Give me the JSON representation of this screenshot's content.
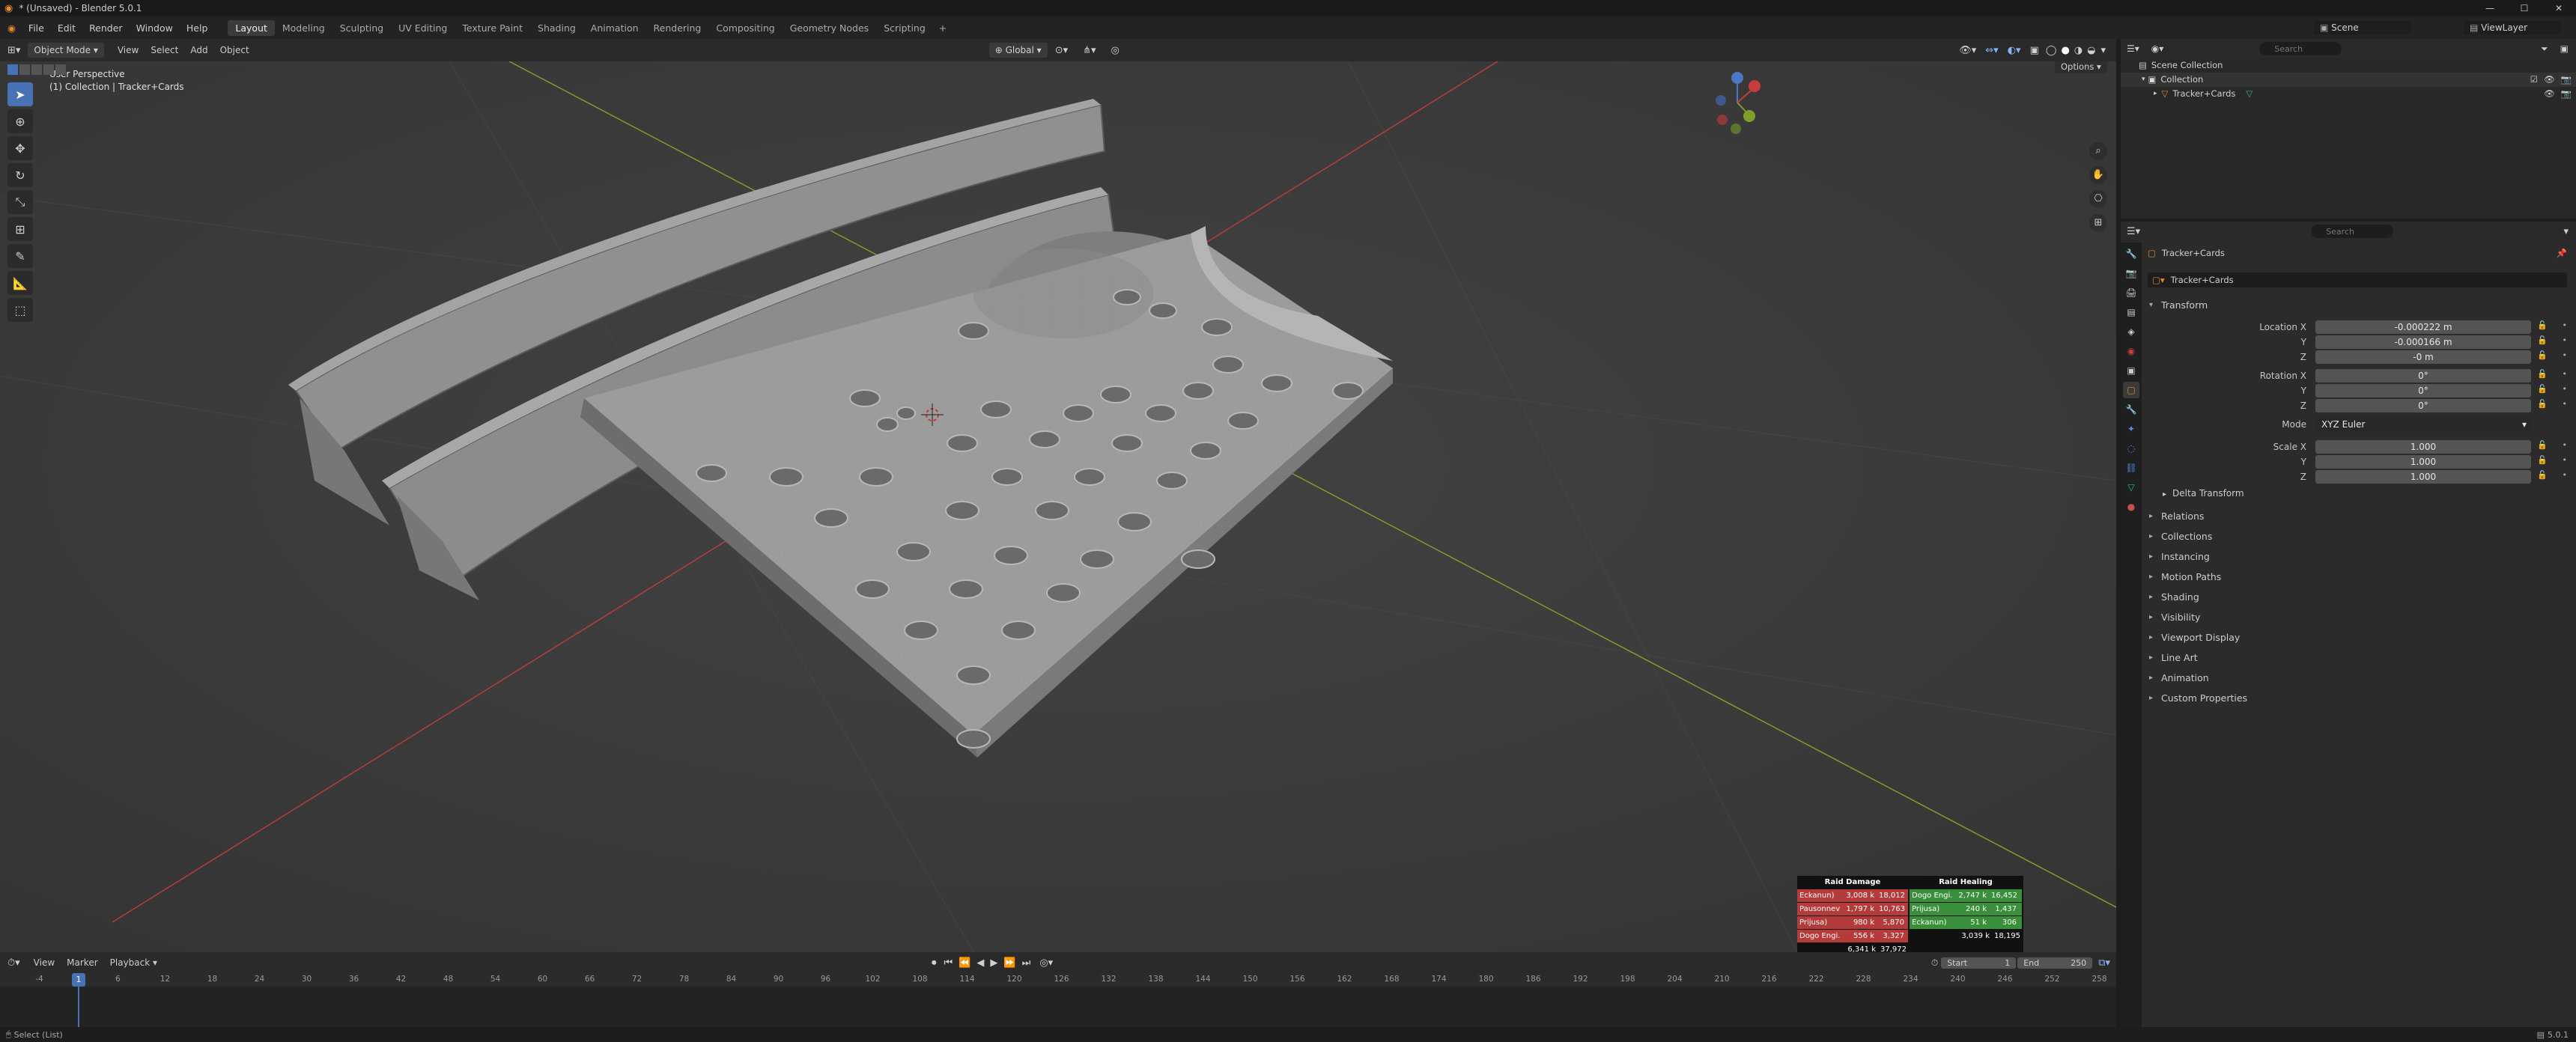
{
  "window": {
    "title": "* (Unsaved) - Blender 5.0.1"
  },
  "menu": {
    "file": "File",
    "edit": "Edit",
    "render": "Render",
    "window": "Window",
    "help": "Help"
  },
  "workspaces": [
    "Layout",
    "Modeling",
    "Sculpting",
    "UV Editing",
    "Texture Paint",
    "Shading",
    "Animation",
    "Rendering",
    "Compositing",
    "Geometry Nodes",
    "Scripting"
  ],
  "scene": {
    "name": "Scene",
    "view_layer": "ViewLayer"
  },
  "viewport_header": {
    "mode": "Object Mode",
    "view": "View",
    "select": "Select",
    "add": "Add",
    "object": "Object",
    "transform": "Global",
    "options": "Options"
  },
  "viewport": {
    "perspective": "User Perspective",
    "context": "(1) Collection | Tracker+Cards"
  },
  "outliner": {
    "search_placeholder": "Search",
    "scene_collection": "Scene Collection",
    "collection": "Collection",
    "object": "Tracker+Cards"
  },
  "properties": {
    "search_placeholder": "Search",
    "object_name": "Tracker+Cards",
    "object_field": "Tracker+Cards",
    "transform": "Transform",
    "location_x_label": "Location X",
    "y_label": "Y",
    "z_label": "Z",
    "location": [
      "-0.000222 m",
      "-0.000166 m",
      "-0 m"
    ],
    "rotation_x_label": "Rotation X",
    "rotation": [
      "0°",
      "0°",
      "0°"
    ],
    "mode_label": "Mode",
    "mode": "XYZ Euler",
    "scale_x_label": "Scale X",
    "scale": [
      "1.000",
      "1.000",
      "1.000"
    ],
    "delta": "Delta Transform",
    "panels": [
      "Relations",
      "Collections",
      "Instancing",
      "Motion Paths",
      "Shading",
      "Visibility",
      "Viewport Display",
      "Line Art",
      "Animation",
      "Custom Properties"
    ]
  },
  "timeline": {
    "playback": "Playback",
    "view": "View",
    "marker": "Marker",
    "start_label": "Start",
    "start": "1",
    "end_label": "End",
    "end": "250",
    "current_frame": "1",
    "ticks": [
      "-4",
      "1",
      "6",
      "12",
      "18",
      "24",
      "30",
      "36",
      "42",
      "48",
      "54",
      "60",
      "66",
      "72",
      "78",
      "84",
      "90",
      "96",
      "102",
      "108",
      "114",
      "120",
      "126",
      "132",
      "138",
      "144",
      "150",
      "156",
      "162",
      "168",
      "174",
      "180",
      "186",
      "192",
      "198",
      "204",
      "210",
      "216",
      "222",
      "228",
      "234",
      "240",
      "246",
      "252",
      "258"
    ]
  },
  "status": {
    "left": "Select (List)",
    "version": "5.0.1"
  },
  "raid": {
    "damage_title": "Raid Damage",
    "healing_title": "Raid Healing",
    "damage": [
      [
        "Eckanun)",
        "3,008 k",
        "18,012"
      ],
      [
        "Pausonnev",
        "1,797 k",
        "10,763"
      ],
      [
        "Prijusa)",
        "980 k",
        "5,870"
      ],
      [
        "Dogo Engi...",
        "556 k",
        "3,327"
      ]
    ],
    "damage_total": [
      "6,341 k",
      "37,972"
    ],
    "healing": [
      [
        "Dogo Engi...",
        "2,747 k",
        "16,452"
      ],
      [
        "Prijusa)",
        "240 k",
        "1,437"
      ],
      [
        "Eckanun)",
        "51 k",
        "306"
      ]
    ],
    "healing_total": [
      "3,039 k",
      "18,195"
    ]
  },
  "colors": {
    "accent": "#4772b3",
    "orange": "#e38b29",
    "axis_x": "#c83c3c",
    "axis_y": "#7ca02a",
    "damage_red": "#b53a3a",
    "healing_green": "#3a8f3a"
  }
}
